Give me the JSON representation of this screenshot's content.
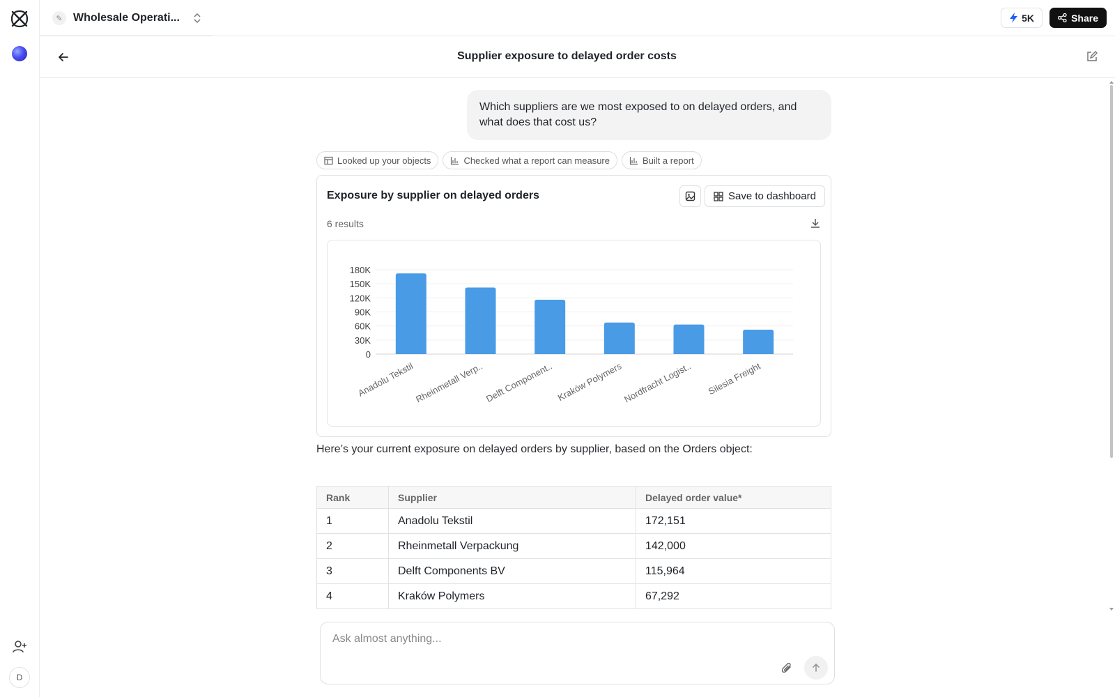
{
  "app": {
    "workspace_name": "Wholesale Operati...",
    "credits_label": "5K",
    "share_label": "Share",
    "avatar_initial": "D"
  },
  "conversation": {
    "title": "Supplier exposure to delayed order costs",
    "user_message": "Which suppliers are we most exposed to on delayed orders, and what does that cost us?",
    "steps": [
      {
        "label": "Looked up your objects",
        "icon": "table-icon"
      },
      {
        "label": "Checked what a report can measure",
        "icon": "bar-chart-icon"
      },
      {
        "label": "Built a report",
        "icon": "bar-chart-icon"
      }
    ],
    "answer_text": "Here’s your current exposure on delayed orders by supplier, based on the Orders object:"
  },
  "report_card": {
    "title": "Exposure by supplier on delayed orders",
    "save_label": "Save to dashboard",
    "results_label": "6 results"
  },
  "chart_data": {
    "type": "bar",
    "categories": [
      "Anadolu Tekstil",
      "Rheinmetall Verp..",
      "Delft Component..",
      "Kraków Polymers",
      "Nordfracht Logist..",
      "Silesia Freight"
    ],
    "values": [
      172151,
      142000,
      115964,
      67292,
      63000,
      52000
    ],
    "ylim": [
      0,
      180000
    ],
    "y_ticks": [
      0,
      30000,
      60000,
      90000,
      120000,
      150000,
      180000
    ],
    "y_tick_labels": [
      "0",
      "30K",
      "60K",
      "90K",
      "120K",
      "150K",
      "180K"
    ],
    "bar_color": "#4a9be6",
    "grid": true,
    "title": "",
    "xlabel": "",
    "ylabel": ""
  },
  "table": {
    "headers": [
      "Rank",
      "Supplier",
      "Delayed order value*"
    ],
    "rows": [
      [
        "1",
        "Anadolu Tekstil",
        "172,151"
      ],
      [
        "2",
        "Rheinmetall Verpackung",
        "142,000"
      ],
      [
        "3",
        "Delft Components BV",
        "115,964"
      ],
      [
        "4",
        "Kraków Polymers",
        "67,292"
      ]
    ]
  },
  "composer": {
    "placeholder": "Ask almost anything..."
  },
  "colors": {
    "accent": "#1f5eff",
    "bar": "#4a9be6",
    "share_bg": "#111111"
  }
}
